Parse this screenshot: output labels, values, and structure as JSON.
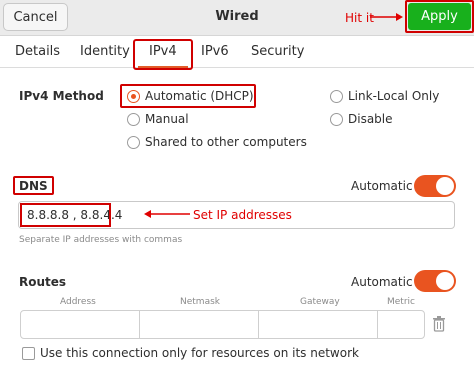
{
  "header": {
    "cancel_label": "Cancel",
    "title": "Wired",
    "annotation_hit": "Hit it",
    "apply_label": "Apply"
  },
  "tabs": [
    {
      "label": "Details"
    },
    {
      "label": "Identity"
    },
    {
      "label": "IPv4",
      "active": true
    },
    {
      "label": "IPv6"
    },
    {
      "label": "Security"
    }
  ],
  "ipv4": {
    "method_label": "IPv4 Method",
    "methods": [
      {
        "label": "Automatic (DHCP)",
        "checked": true
      },
      {
        "label": "Link-Local Only",
        "checked": false
      },
      {
        "label": "Manual",
        "checked": false
      },
      {
        "label": "Disable",
        "checked": false
      },
      {
        "label": "Shared to other computers",
        "checked": false
      }
    ]
  },
  "dns": {
    "label": "DNS",
    "automatic_label": "Automatic",
    "automatic_on": true,
    "value": "8.8.8.8 , 8.8.4.4",
    "annotation": "Set IP addresses",
    "hint": "Separate IP addresses with commas"
  },
  "routes": {
    "label": "Routes",
    "automatic_label": "Automatic",
    "automatic_on": true,
    "columns": [
      "Address",
      "Netmask",
      "Gateway",
      "Metric"
    ]
  },
  "only_resources_label": "Use this connection only for resources on its network",
  "colors": {
    "accent": "#e95420",
    "apply_green": "#18b01c",
    "annotation_red": "#d00000"
  }
}
